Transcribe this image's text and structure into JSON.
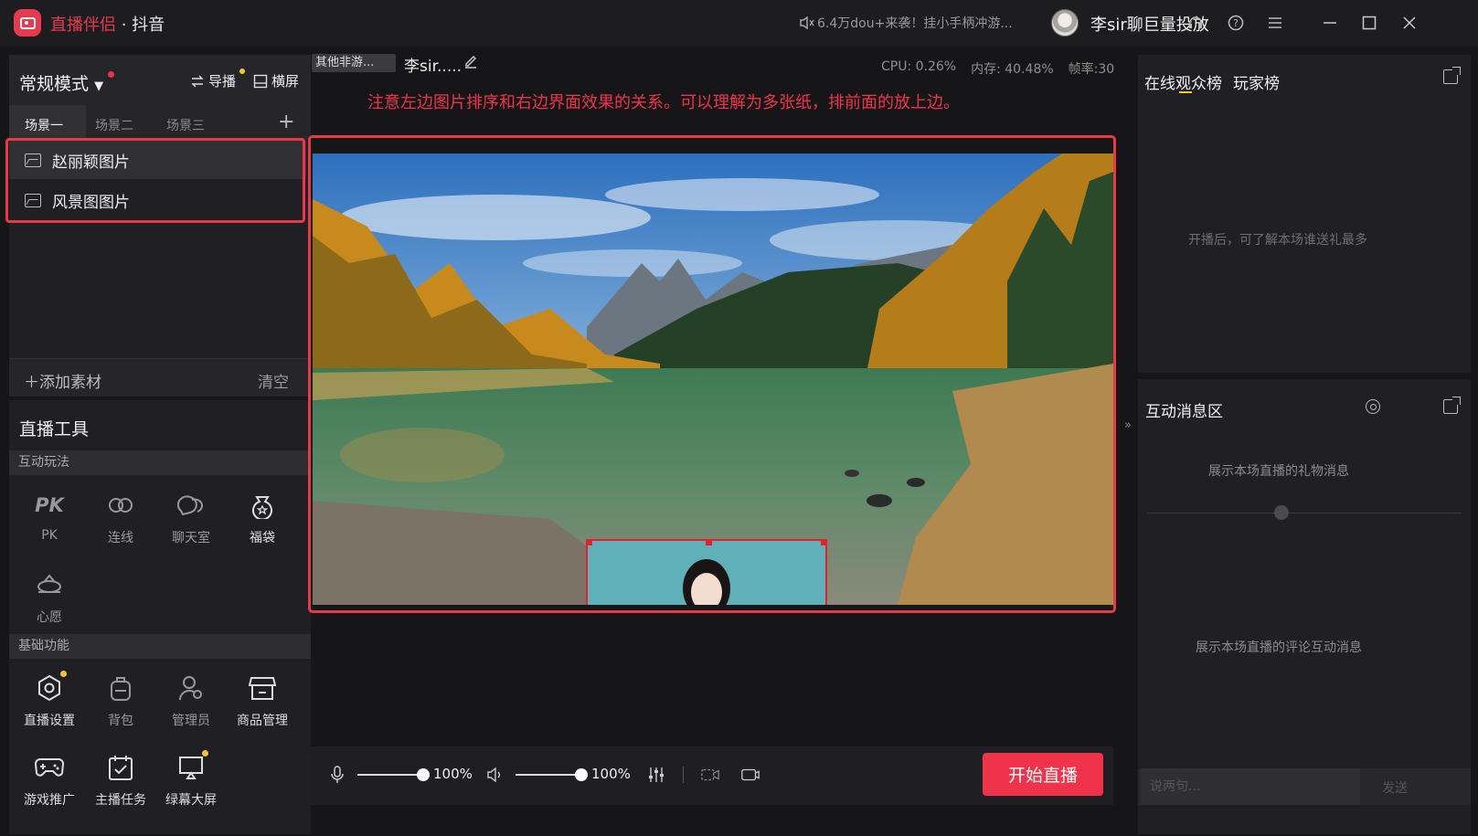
{
  "titlebar": {
    "app_name": "直播伴侣",
    "app_sub": " · 抖音",
    "notice": "6.4万dou+来袭！挂小手柄冲游...",
    "username": "李sir聊巨量投放"
  },
  "left": {
    "mode": "常规模式",
    "guide": "导播",
    "landscape": "横屏",
    "scenes": [
      "场景一",
      "场景二",
      "场景三"
    ],
    "sources": [
      "赵丽颖图片",
      "风景图图片"
    ],
    "add_material": "添加素材",
    "clear": "清空",
    "tools_title": "直播工具",
    "interactive_section": "互动玩法",
    "interactive_tools": [
      "PK",
      "连线",
      "聊天室",
      "福袋",
      "心愿"
    ],
    "basic_section": "基础功能",
    "basic_tools": [
      "直播设置",
      "背包",
      "管理员",
      "商品管理",
      "游戏推广",
      "主播任务",
      "绿幕大屏"
    ]
  },
  "center": {
    "scene_chip": "其他非游...",
    "stream_name": "李sir.....",
    "cpu": "CPU: 0.26%",
    "memory": "内存: 40.48%",
    "fps": "帧率:30",
    "note": "注意左边图片排序和右边界面效果的关系。可以理解为多张纸，排前面的放上边。",
    "mic_volume": "100%",
    "speaker_volume": "100%",
    "mic_level": 1.0,
    "speaker_level": 1.0,
    "start_button": "开始直播"
  },
  "right": {
    "tab_online": "在线观众榜",
    "tab_players": "玩家榜",
    "rank_empty": "开播后，可了解本场谁送礼最多",
    "msg_title": "互动消息区",
    "gift_msg": "展示本场直播的礼物消息",
    "comment_msg": "展示本场直播的评论互动消息",
    "input_placeholder": "说两句...",
    "send": "发送"
  },
  "colors": {
    "accent": "#f0334b",
    "badge": "#f5c431",
    "panel": "#202024",
    "background": "#161618"
  }
}
